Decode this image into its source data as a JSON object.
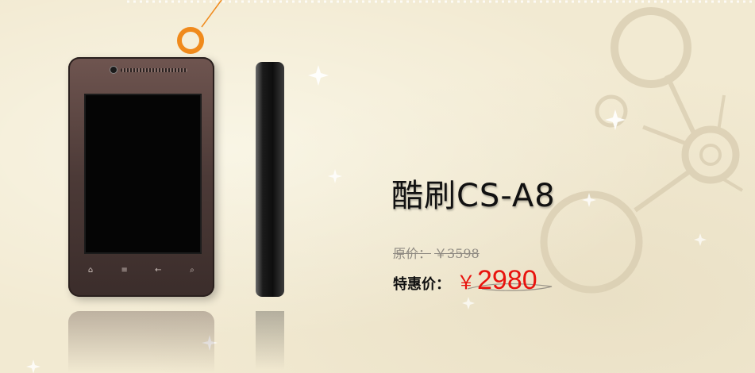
{
  "product": {
    "name": "酷刷CS-A8",
    "original_price_label": "原价：",
    "original_price": "￥3598",
    "sale_price_label": "特惠价：",
    "sale_price_currency": "￥",
    "sale_price": "2980"
  },
  "phone_keys": [
    "⌂",
    "≡",
    "←",
    "⌕"
  ],
  "colors": {
    "background": "#f2ead2",
    "accent_orange": "#f08a1c",
    "price_red": "#e8130e",
    "title_text": "#111111",
    "strike_gray": "#8f8a82"
  }
}
